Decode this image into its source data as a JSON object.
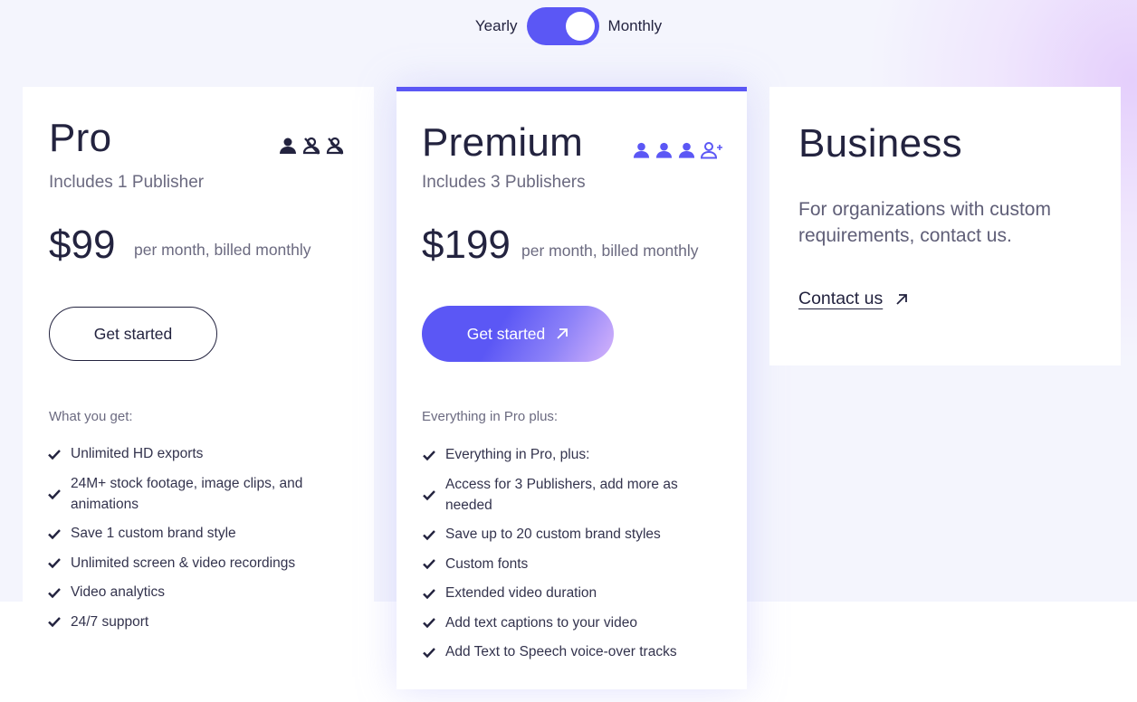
{
  "billing_toggle": {
    "left_label": "Yearly",
    "right_label": "Monthly",
    "selected": "Monthly"
  },
  "colors": {
    "accent": "#5b57f5",
    "text_dark": "#23233f",
    "text_muted": "#6b6a80"
  },
  "plans": [
    {
      "name": "Pro",
      "subtitle": "Includes 1 Publisher",
      "price": "$99",
      "price_note": "per month, billed monthly",
      "publisher_icons": [
        "user-filled-icon",
        "user-disabled-icon",
        "user-disabled-icon"
      ],
      "cta_label": "Get started",
      "features_heading": "What you get:",
      "features": [
        "Unlimited HD exports",
        "24M+ stock footage, image clips, and animations",
        "Save 1 custom brand style",
        "Unlimited screen & video recordings",
        "Video analytics",
        "24/7 support"
      ]
    },
    {
      "name": "Premium",
      "subtitle": "Includes 3 Publishers",
      "price": "$199",
      "price_note": "per month, billed monthly",
      "publisher_icons": [
        "user-filled-icon",
        "user-filled-icon",
        "user-filled-icon",
        "user-add-icon"
      ],
      "cta_label": "Get started",
      "cta_icon": "arrow-up-right-icon",
      "features_heading": "Everything in Pro plus:",
      "features": [
        "Everything in Pro, plus:",
        "Access for 3 Publishers, add more as needed",
        "Save up to 20 custom brand styles",
        "Custom fonts",
        "Extended video duration",
        "Add text captions to your video",
        "Add Text to Speech voice-over tracks"
      ]
    },
    {
      "name": "Business",
      "description": "For organizations with custom requirements, contact us.",
      "link_label": "Contact us",
      "link_icon": "arrow-up-right-icon"
    }
  ]
}
